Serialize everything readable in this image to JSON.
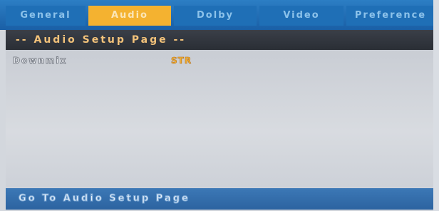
{
  "tabs": [
    {
      "label": "General"
    },
    {
      "label": "Audio"
    },
    {
      "label": "Dolby"
    },
    {
      "label": "Video"
    },
    {
      "label": "Preference"
    }
  ],
  "active_tab": "Audio",
  "header": {
    "title": "-- Audio Setup Page --"
  },
  "settings": [
    {
      "label": "Downmix",
      "value": "STR"
    }
  ],
  "footer": {
    "status": "Go To Audio Setup Page"
  },
  "colors": {
    "tab_bar": "#1f6fb6",
    "active_tab": "#f4b230",
    "header_bg": "#2a2e35",
    "header_text": "#f2c27a",
    "content_bg": "#d0d4da",
    "value_text": "#f2b23a",
    "footer_bg": "#2c63a0"
  }
}
